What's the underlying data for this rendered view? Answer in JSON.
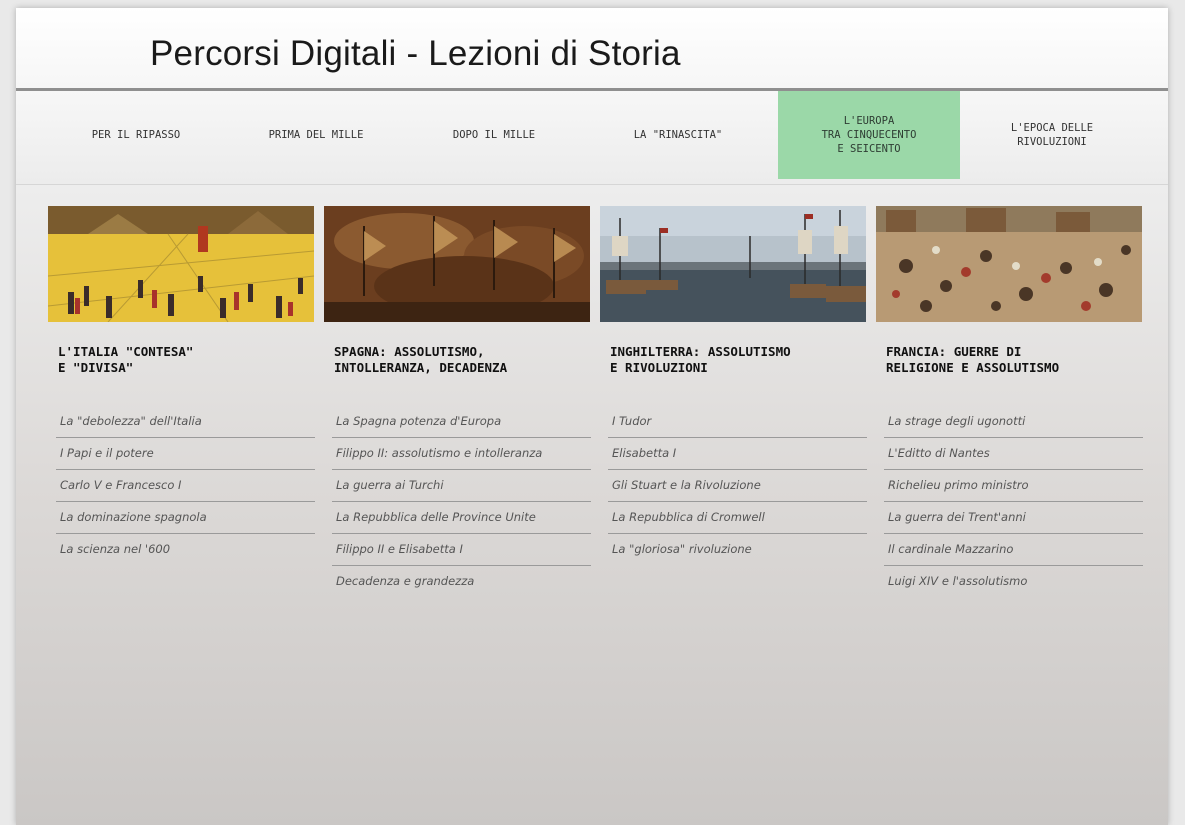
{
  "header": {
    "title": "Percorsi Digitali - Lezioni di Storia"
  },
  "nav": {
    "items": [
      {
        "label": "PER IL RIPASSO"
      },
      {
        "label": "PRIMA DEL MILLE"
      },
      {
        "label": "DOPO IL MILLE"
      },
      {
        "label": "LA \"RINASCITA\""
      },
      {
        "label": "L'EUROPA\nTRA CINQUECENTO\nE SEICENTO"
      },
      {
        "label": "L'EPOCA DELLE\nRIVOLUZIONI"
      }
    ],
    "active_index": 4,
    "active_color": "#9bd8a8"
  },
  "columns": [
    {
      "image": "piazza-painting",
      "title": "L'ITALIA \"CONTESA\"\nE \"DIVISA\"",
      "links": [
        "La \"debolezza\" dell'Italia",
        "I Papi e il potere",
        "Carlo V e Francesco I",
        "La dominazione spagnola",
        "La scienza nel '600"
      ]
    },
    {
      "image": "naval-battle-painting",
      "title": "SPAGNA: ASSOLUTISMO,\nINTOLLERANZA, DECADENZA",
      "links": [
        "La Spagna potenza d'Europa",
        "Filippo II: assolutismo e intolleranza",
        "La guerra ai Turchi",
        "La Repubblica delle Province Unite",
        "Filippo II e Elisabetta I",
        "Decadenza e grandezza"
      ]
    },
    {
      "image": "harbor-ships-painting",
      "title": "INGHILTERRA: ASSOLUTISMO\nE RIVOLUZIONI",
      "links": [
        "I Tudor",
        "Elisabetta I",
        "Gli Stuart e la Rivoluzione",
        "La Repubblica di Cromwell",
        "La \"gloriosa\" rivoluzione"
      ]
    },
    {
      "image": "massacre-painting",
      "title": "FRANCIA: GUERRE DI\nRELIGIONE E ASSOLUTISMO",
      "links": [
        "La strage degli ugonotti",
        "L'Editto di Nantes",
        "Richelieu primo ministro",
        "La guerra dei Trent'anni",
        "Il cardinale Mazzarino",
        "Luigi XIV e l'assolutismo"
      ]
    }
  ]
}
